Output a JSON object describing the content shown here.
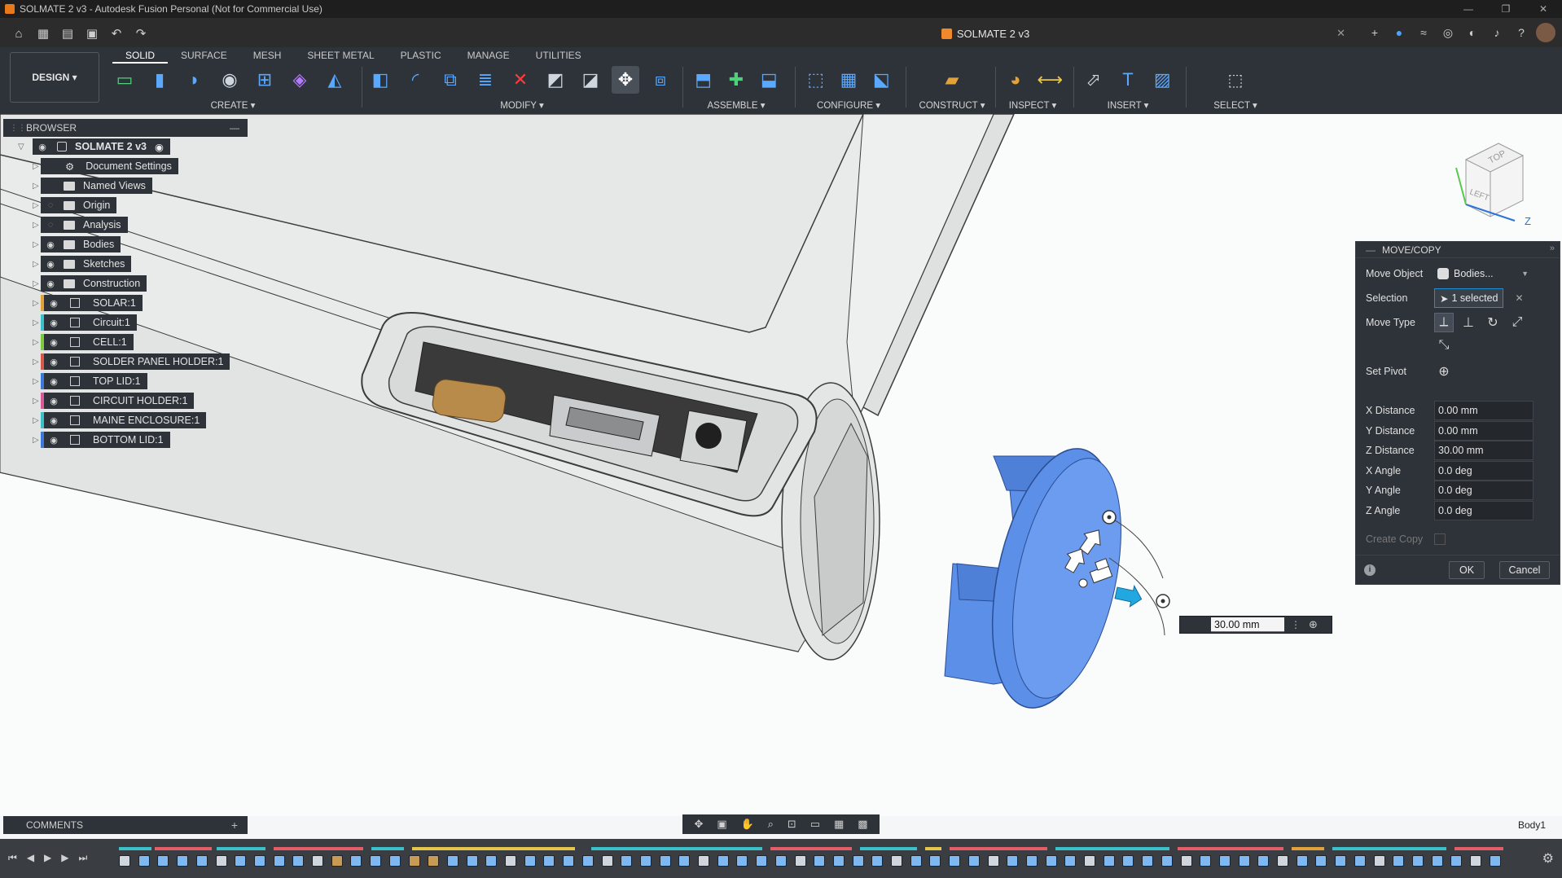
{
  "window": {
    "title": "SOLMATE 2 v3 - Autodesk Fusion Personal (Not for Commercial Use)",
    "controls": [
      "—",
      "❐",
      "✕"
    ]
  },
  "doc_tab": {
    "title": "SOLMATE 2 v3",
    "close": "✕"
  },
  "workspace": {
    "label": "DESIGN ▾"
  },
  "tabs": [
    "SOLID",
    "SURFACE",
    "MESH",
    "SHEET METAL",
    "PLASTIC",
    "MANAGE",
    "UTILITIES"
  ],
  "tool_groups": [
    {
      "label": "CREATE ▾",
      "icons": [
        "new-sketch-icon",
        "extrude-icon",
        "revolve-icon",
        "hole-icon",
        "pattern-icon",
        "create-form-icon",
        "mirror-icon"
      ]
    },
    {
      "label": "MODIFY ▾",
      "icons": [
        "press-pull-icon",
        "fillet-icon",
        "combine-icon",
        "offset-face-icon",
        "delete-icon",
        "split-body-icon",
        "split-face-icon",
        "move-copy-icon",
        "scale-icon"
      ]
    },
    {
      "label": "ASSEMBLE ▾",
      "icons": [
        "new-component-icon",
        "joint-icon",
        "as-built-joint-icon"
      ]
    },
    {
      "label": "CONFIGURE ▾",
      "icons": [
        "configure-icon",
        "config-table-icon",
        "config-rule-icon"
      ]
    },
    {
      "label": "CONSTRUCT ▾",
      "icons": [
        "offset-plane-icon"
      ]
    },
    {
      "label": "INSPECT ▾",
      "icons": [
        "appearance-icon",
        "measure-icon"
      ]
    },
    {
      "label": "INSERT ▾",
      "icons": [
        "insert-derive-icon",
        "insert-text-icon",
        "insert-image-icon"
      ]
    },
    {
      "label": "SELECT ▾",
      "icons": [
        "select-window-icon"
      ]
    }
  ],
  "browser": {
    "title": "BROWSER",
    "root": "SOLMATE 2 v3",
    "items": [
      {
        "label": "Document Settings",
        "kind": "settings",
        "eye": "",
        "color": ""
      },
      {
        "label": "Named Views",
        "kind": "folder",
        "eye": "",
        "color": ""
      },
      {
        "label": "Origin",
        "kind": "folder",
        "eye": "off",
        "color": ""
      },
      {
        "label": "Analysis",
        "kind": "folder",
        "eye": "off",
        "color": ""
      },
      {
        "label": "Bodies",
        "kind": "folder",
        "eye": "on",
        "color": ""
      },
      {
        "label": "Sketches",
        "kind": "folder",
        "eye": "on",
        "color": ""
      },
      {
        "label": "Construction",
        "kind": "folder",
        "eye": "on",
        "color": ""
      },
      {
        "label": "SOLAR:1",
        "kind": "component",
        "eye": "on",
        "color": "#e2a23a"
      },
      {
        "label": "Circuit:1",
        "kind": "component",
        "eye": "on",
        "color": "#3bc1c9"
      },
      {
        "label": "CELL:1",
        "kind": "component",
        "eye": "on",
        "color": "#7acb3e"
      },
      {
        "label": "SOLDER PANEL HOLDER:1",
        "kind": "component",
        "eye": "on",
        "color": "#d8594a"
      },
      {
        "label": "TOP LID:1",
        "kind": "component",
        "eye": "on",
        "color": "#3a7ad8"
      },
      {
        "label": "CIRCUIT HOLDER:1",
        "kind": "component",
        "eye": "on",
        "color": "#d85a9a"
      },
      {
        "label": "MAINE ENCLOSURE:1",
        "kind": "component",
        "eye": "on",
        "color": "#3bc1c9"
      },
      {
        "label": "BOTTOM LID:1",
        "kind": "component",
        "eye": "on",
        "color": "#3a7ad8"
      }
    ]
  },
  "move_copy": {
    "title": "MOVE/COPY",
    "move_object_label": "Move Object",
    "move_object_value": "Bodies...",
    "selection_label": "Selection",
    "selection_value": "1 selected",
    "move_type_label": "Move Type",
    "set_pivot_label": "Set Pivot",
    "fields": [
      {
        "label": "X Distance",
        "value": "0.00 mm"
      },
      {
        "label": "Y Distance",
        "value": "0.00 mm"
      },
      {
        "label": "Z Distance",
        "value": "30.00 mm"
      },
      {
        "label": "X Angle",
        "value": "0.0 deg"
      },
      {
        "label": "Y Angle",
        "value": "0.0 deg"
      },
      {
        "label": "Z Angle",
        "value": "0.0 deg"
      }
    ],
    "create_copy_label": "Create Copy",
    "ok": "OK",
    "cancel": "Cancel"
  },
  "canvas_input": {
    "value": "30.00 mm"
  },
  "viewcube": {
    "top": "TOP",
    "left": "LEFT",
    "axis_z": "Z"
  },
  "comments": {
    "title": "COMMENTS"
  },
  "status": {
    "selection": "Body1"
  },
  "colors": {
    "accent": "#1e8fd6",
    "part_blue": "#5b8fe8",
    "panel": "#2e3339"
  }
}
